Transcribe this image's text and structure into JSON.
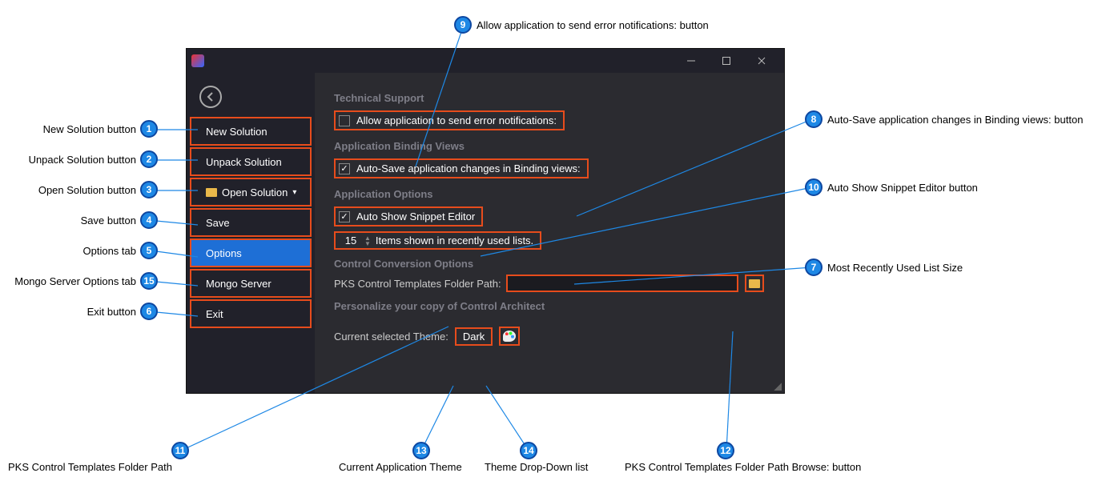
{
  "titlebar": {},
  "sidebar": {
    "items": [
      {
        "label": "New Solution"
      },
      {
        "label": "Unpack Solution"
      },
      {
        "label": "Open Solution"
      },
      {
        "label": "Save"
      },
      {
        "label": "Options"
      },
      {
        "label": "Mongo Server"
      },
      {
        "label": "Exit"
      }
    ]
  },
  "sections": {
    "tech_support": {
      "heading": "Technical Support",
      "allow_errors_label": "Allow application to send error notifications:",
      "allow_errors_checked": false
    },
    "binding_views": {
      "heading": "Application Binding Views",
      "autosave_label": "Auto-Save application changes in Binding views:",
      "autosave_checked": true
    },
    "app_options": {
      "heading": "Application Options",
      "auto_snippet_label": "Auto Show Snippet Editor",
      "auto_snippet_checked": true,
      "mru_value": "15",
      "mru_suffix": "Items shown in recently used lists."
    },
    "control_conversion": {
      "heading": "Control Conversion Options",
      "path_label": "PKS Control Templates Folder Path:",
      "path_value": ""
    },
    "personalize": {
      "heading": "Personalize your copy of Control Architect",
      "theme_label": "Current selected Theme:",
      "theme_value": "Dark"
    }
  },
  "callouts": {
    "c1": {
      "num": "1",
      "text": "New Solution button"
    },
    "c2": {
      "num": "2",
      "text": "Unpack Solution button"
    },
    "c3": {
      "num": "3",
      "text": "Open Solution button"
    },
    "c4": {
      "num": "4",
      "text": "Save button"
    },
    "c5": {
      "num": "5",
      "text": "Options tab"
    },
    "c6": {
      "num": "6",
      "text": "Exit button"
    },
    "c7": {
      "num": "7",
      "text": "Most Recently Used List Size"
    },
    "c8": {
      "num": "8",
      "text": "Auto-Save application changes in Binding views: button"
    },
    "c9": {
      "num": "9",
      "text": "Allow application to send error notifications: button"
    },
    "c10": {
      "num": "10",
      "text": "Auto Show Snippet Editor button"
    },
    "c11": {
      "num": "11",
      "text": "PKS Control Templates Folder Path"
    },
    "c12": {
      "num": "12",
      "text": "PKS Control Templates Folder Path Browse: button"
    },
    "c13": {
      "num": "13",
      "text": "Current Application Theme"
    },
    "c14": {
      "num": "14",
      "text": "Theme Drop-Down list"
    },
    "c15": {
      "num": "15",
      "text": "Mongo Server Options tab"
    }
  }
}
